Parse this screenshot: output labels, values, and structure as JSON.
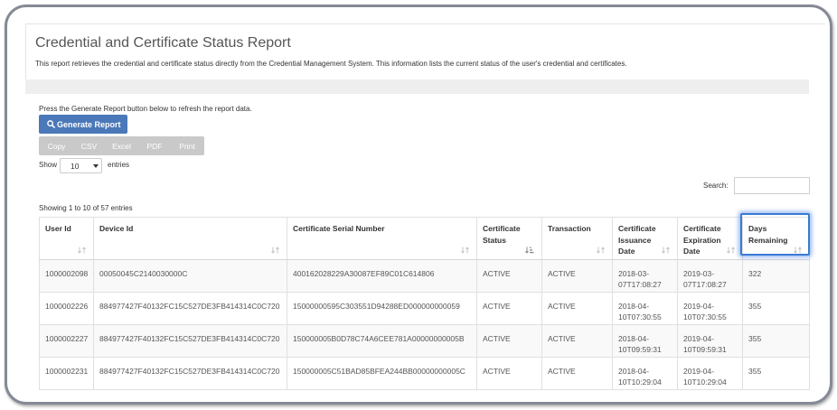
{
  "report": {
    "title": "Credential and Certificate Status Report",
    "description": "This report retrieves the credential and certificate status directly from the Credential Management System. This information lists the current status of the user's credential and certificates."
  },
  "controls": {
    "instruction": "Press the Generate Report button below to refresh the report data.",
    "generate_label": "Generate Report",
    "generate_icon": "search-icon",
    "export_buttons": [
      "Copy",
      "CSV",
      "Excel",
      "PDF",
      "Print"
    ],
    "show_label": "Show",
    "page_length": "10",
    "page_length_icon": "caret-down-icon",
    "entries_label": "entries",
    "search_label": "Search:"
  },
  "table": {
    "info": "Showing 1 to 10 of 57 entries",
    "columns": [
      {
        "label": "User Id",
        "sort_icon": "sort-icon"
      },
      {
        "label": "Device Id",
        "sort_icon": "sort-icon"
      },
      {
        "label": "Certificate Serial Number",
        "sort_icon": "sort-icon"
      },
      {
        "label": "Certificate Status",
        "sort_icon": "sort-asc-icon"
      },
      {
        "label": "Transaction",
        "sort_icon": "sort-icon"
      },
      {
        "label": "Certificate Issuance Date",
        "sort_icon": "sort-icon"
      },
      {
        "label": "Certificate Expiration Date",
        "sort_icon": "sort-icon"
      },
      {
        "label": "Days Remaining",
        "sort_icon": "sort-icon"
      }
    ],
    "rows": [
      {
        "user_id": "1000002098",
        "device_id": "00050045C2140030000C",
        "serial": "400162028229A30087EF89C01C614806",
        "status": "ACTIVE",
        "transaction": "ACTIVE",
        "issued": "2018-03-07T17:08:27",
        "expires": "2019-03-07T17:08:27",
        "days_remaining": "322"
      },
      {
        "user_id": "1000002226",
        "device_id": "884977427F40132FC15C527DE3FB414314C0C720",
        "serial": "15000000595C303551D94288ED000000000059",
        "status": "ACTIVE",
        "transaction": "ACTIVE",
        "issued": "2018-04-10T07:30:55",
        "expires": "2019-04-10T07:30:55",
        "days_remaining": "355"
      },
      {
        "user_id": "1000002227",
        "device_id": "884977427F40132FC15C527DE3FB414314C0C720",
        "serial": "150000005B0D78C74A6CEE781A00000000005B",
        "status": "ACTIVE",
        "transaction": "ACTIVE",
        "issued": "2018-04-10T09:59:31",
        "expires": "2019-04-10T09:59:31",
        "days_remaining": "355"
      },
      {
        "user_id": "1000002231",
        "device_id": "884977427F40132FC15C527DE3FB414314C0C720",
        "serial": "150000005C51BAD85BFEA244BB00000000005C",
        "status": "ACTIVE",
        "transaction": "ACTIVE",
        "issued": "2018-04-10T10:29:04",
        "expires": "2019-04-10T10:29:04",
        "days_remaining": "355"
      }
    ]
  },
  "colors": {
    "primary_button": "#4b78b8",
    "export_buttons": "#c9c9c9",
    "highlight": "#3a7bd5",
    "frame": "#858a96",
    "muted_text": "#555555"
  }
}
